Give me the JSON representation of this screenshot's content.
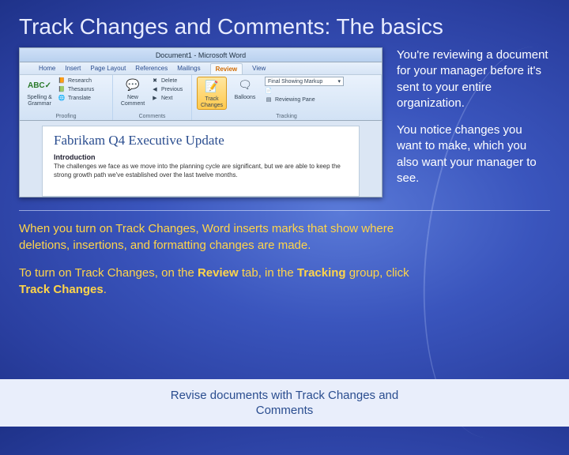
{
  "title": "Track Changes and Comments: The basics",
  "word": {
    "titlebar": "Document1 - Microsoft Word",
    "tabs": [
      "Home",
      "Insert",
      "Page Layout",
      "References",
      "Mailings",
      "Review",
      "View"
    ],
    "active_tab": "Review",
    "groups": {
      "proofing": {
        "label": "Proofing",
        "spelling": "Spelling &\nGrammar",
        "research": "Research",
        "thesaurus": "Thesaurus",
        "translate": "Translate"
      },
      "comments": {
        "label": "Comments",
        "new": "New\nComment",
        "delete": "Delete",
        "previous": "Previous",
        "next": "Next"
      },
      "tracking": {
        "label": "Tracking",
        "track": "Track\nChanges",
        "balloons": "Balloons",
        "markup": "Final Showing Markup",
        "pane": "Reviewing Pane"
      }
    },
    "doc": {
      "title": "Fabrikam Q4 Executive Update",
      "h2": "Introduction",
      "body": "The challenges we face as we move into the planning cycle are significant, but we are able to keep the strong growth path we've established over the last twelve months."
    }
  },
  "side": {
    "p1": "You're reviewing a document for your manager before it's sent to your entire organization.",
    "p2": "You notice changes you want to make, which you also want your manager to see."
  },
  "lower": {
    "p1": "When you turn on Track Changes, Word inserts marks that show where deletions, insertions, and formatting changes are made.",
    "p2a": "To turn on Track Changes, on the ",
    "p2b": "Review",
    "p2c": " tab, in the ",
    "p2d": "Tracking",
    "p2e": " group, click ",
    "p2f": "Track Changes",
    "p2g": "."
  },
  "footer": "Revise documents with Track Changes and Comments"
}
